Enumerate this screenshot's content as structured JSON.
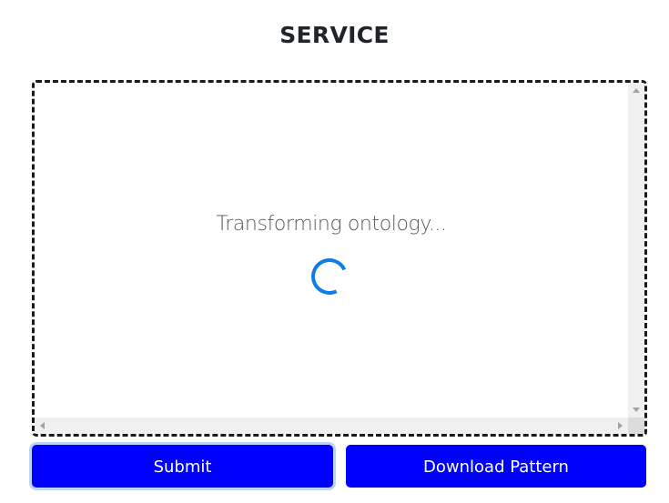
{
  "page": {
    "title": "SERVICE"
  },
  "panel": {
    "status_text": "Transforming ontology...",
    "spinner_icon": "loading-spinner-icon",
    "spinner_color": "#0d7ee9"
  },
  "actions": {
    "submit_label": "Submit",
    "download_label": "Download Pattern",
    "button_color": "#0000ff"
  }
}
